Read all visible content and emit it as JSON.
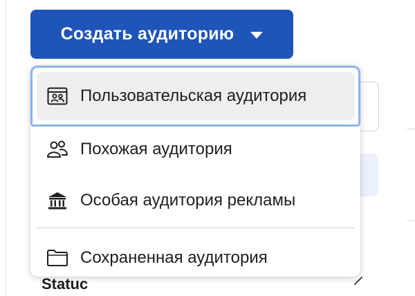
{
  "create_button": {
    "label": "Создать аудиторию",
    "caret_icon": "caret-down-icon"
  },
  "dropdown": {
    "items": [
      {
        "label": "Пользовательская аудитория",
        "icon": "custom-audience-icon",
        "highlighted": true
      },
      {
        "label": "Похожая аудитория",
        "icon": "people-icon",
        "highlighted": false
      },
      {
        "label": "Особая аудитория рекламы",
        "icon": "bank-building-icon",
        "highlighted": false
      },
      {
        "label": "Сохраненная аудитория",
        "icon": "folder-icon",
        "highlighted": false
      }
    ]
  },
  "background": {
    "status_label": "Statuc"
  },
  "colors": {
    "primary_button": "#1f55b8",
    "focus_ring": "#8fb4ea",
    "hover_bg": "#eeeeee",
    "text": "#1c1e21"
  }
}
